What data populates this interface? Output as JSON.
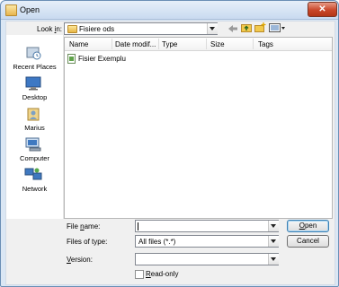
{
  "window": {
    "title": "Open",
    "close_glyph": "✕"
  },
  "lookin": {
    "label_pre": "Look ",
    "label_key": "i",
    "label_post": "n:",
    "value": "Fisiere ods"
  },
  "toolbar": {
    "icons": [
      "back-arrow-icon",
      "up-folder-icon",
      "new-folder-icon",
      "views-menu-icon"
    ]
  },
  "places": [
    {
      "label": "Recent Places",
      "icon": "recent-places-icon"
    },
    {
      "label": "Desktop",
      "icon": "desktop-icon"
    },
    {
      "label": "Marius",
      "icon": "user-folder-icon"
    },
    {
      "label": "Computer",
      "icon": "computer-icon"
    },
    {
      "label": "Network",
      "icon": "network-icon"
    }
  ],
  "columns": [
    "Name",
    "Date modif...",
    "Type",
    "Size",
    "Tags"
  ],
  "files": [
    {
      "name": "Fisier Exemplu",
      "icon": "ods-document-icon"
    }
  ],
  "filename": {
    "label_pre": "File ",
    "label_key": "n",
    "label_post": "ame:",
    "value": ""
  },
  "filetype": {
    "label": "Files of type:",
    "value": "All files (*.*)"
  },
  "version": {
    "label_key": "V",
    "label_post": "ersion:",
    "value": ""
  },
  "readonly": {
    "label_key": "R",
    "label_post": "ead-only",
    "checked": false
  },
  "buttons": {
    "open_key": "O",
    "open_post": "pen",
    "cancel": "Cancel"
  }
}
